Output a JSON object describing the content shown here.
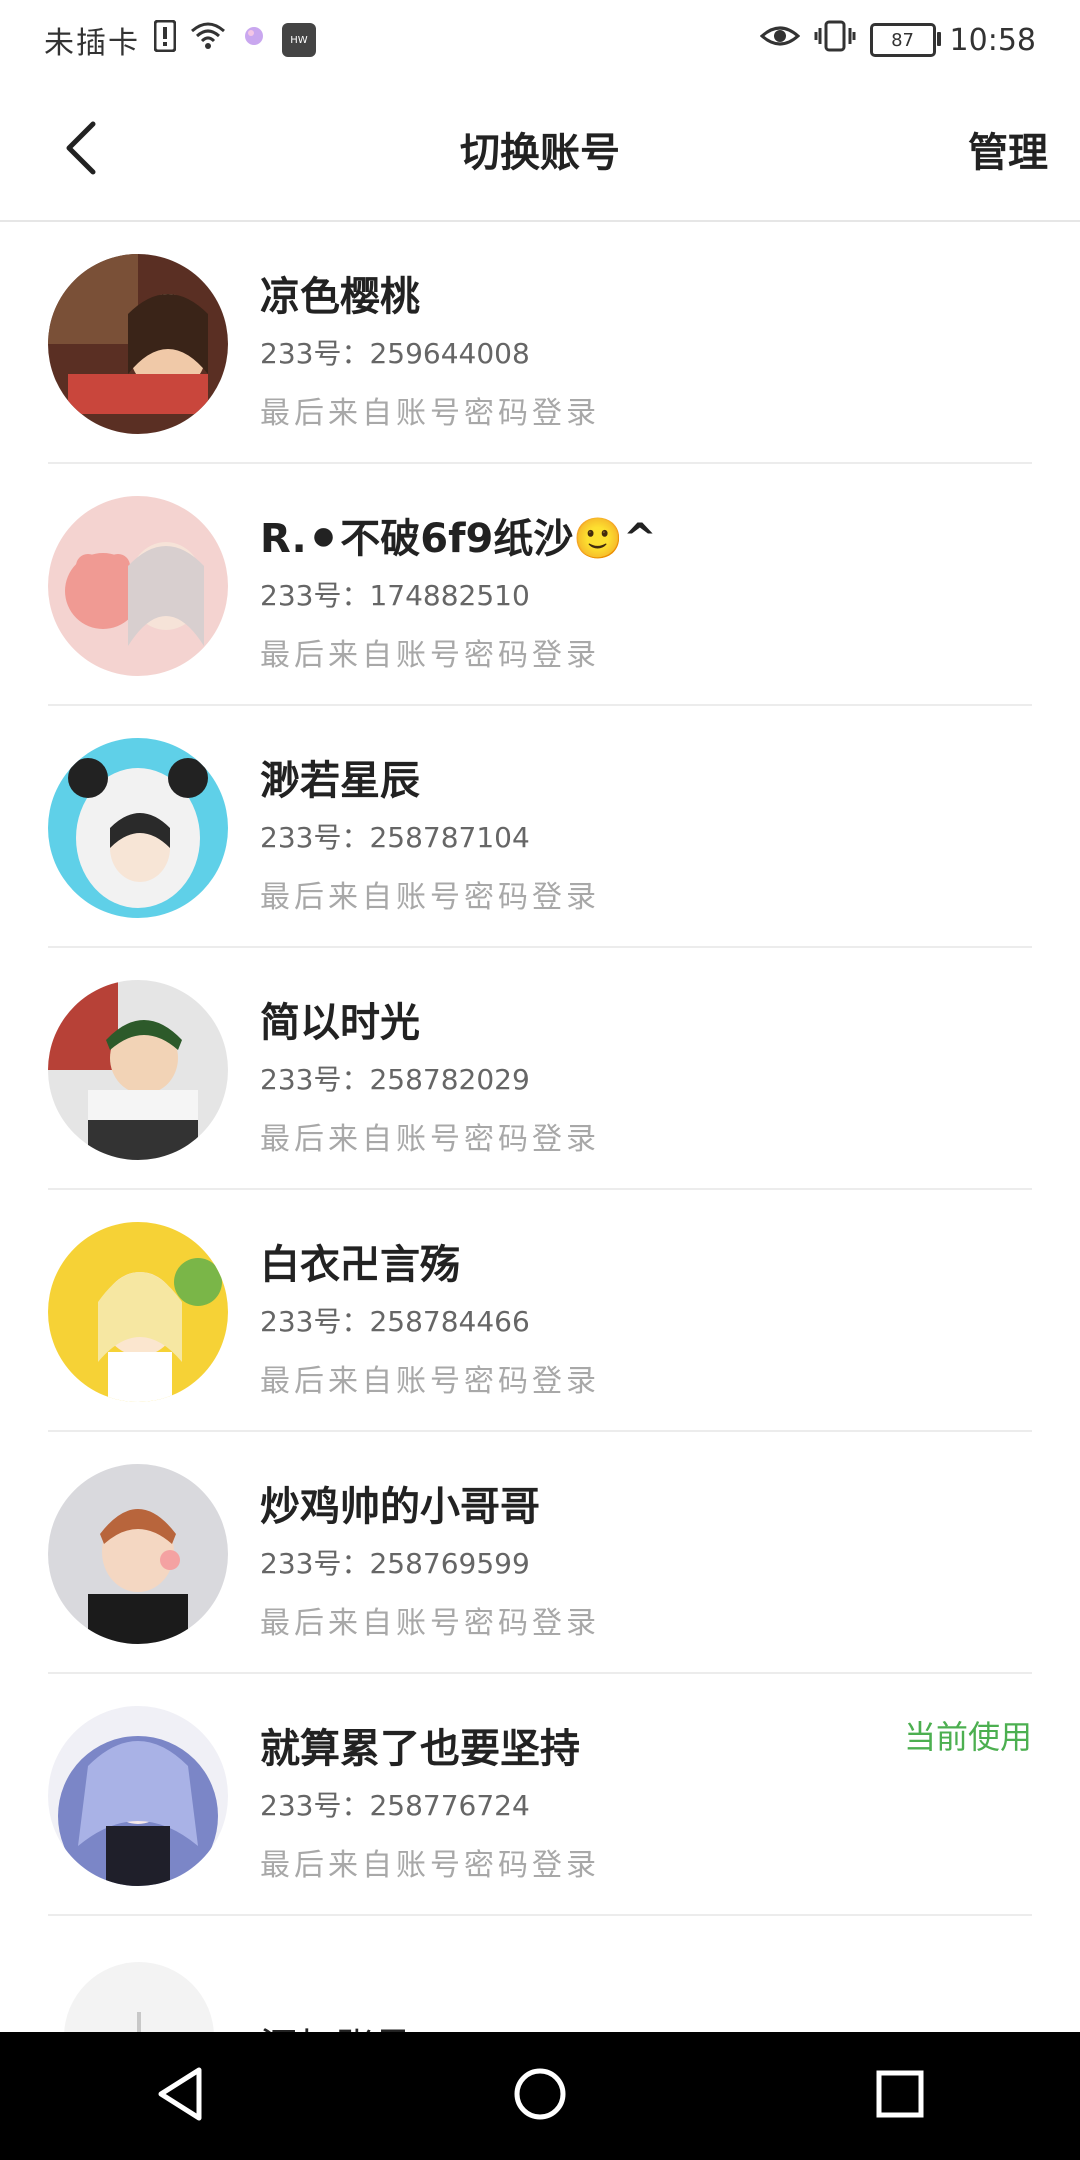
{
  "status": {
    "carrier": "未插卡",
    "battery": "87",
    "time": "10:58"
  },
  "header": {
    "title": "切换账号",
    "manage_label": "管理"
  },
  "accounts": [
    {
      "nickname": "凉色樱桃",
      "uid": "233号：259644008",
      "login": "最后来自账号密码登录"
    },
    {
      "nickname": "R.⚫不破6f9纸沙🙂^",
      "uid": "233号：174882510",
      "login": "最后来自账号密码登录"
    },
    {
      "nickname": "渺若星辰",
      "uid": "233号：258787104",
      "login": "最后来自账号密码登录"
    },
    {
      "nickname": "简以时光",
      "uid": "233号：258782029",
      "login": "最后来自账号密码登录"
    },
    {
      "nickname": "白衣卍言殇",
      "uid": "233号：258784466",
      "login": "最后来自账号密码登录"
    },
    {
      "nickname": "炒鸡帅的小哥哥",
      "uid": "233号：258769599",
      "login": "最后来自账号密码登录"
    },
    {
      "nickname": "就算累了也要坚持",
      "uid": "233号：258776724",
      "login": "最后来自账号密码登录",
      "badge": "当前使用"
    }
  ],
  "add_row": {
    "label": "添加账号"
  },
  "colors": {
    "badge_green": "#4caf50",
    "divider": "#ececec",
    "navbar": "#000000"
  },
  "icons": {
    "back": "chevron-left-icon",
    "nav_back": "triangle-back-icon",
    "nav_home": "circle-home-icon",
    "nav_recent": "square-recent-icon"
  }
}
